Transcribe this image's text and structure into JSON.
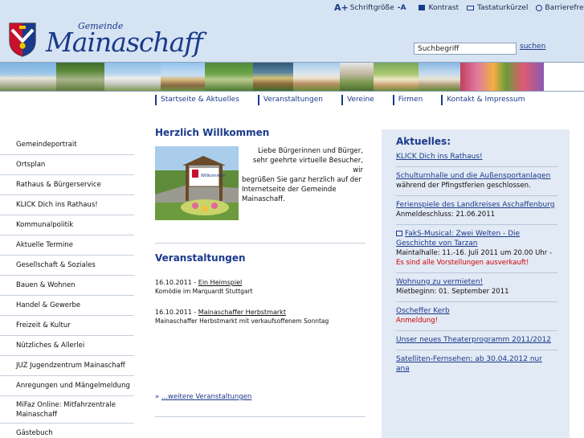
{
  "utility": {
    "font_size_label": "Schriftgröße",
    "font_plus": "A+",
    "font_minus": "-A",
    "contrast": "Kontrast",
    "shortcuts": "Tastaturkürzel",
    "accessible": "Barrierefrei"
  },
  "logo": {
    "small": "Gemeinde",
    "big": "Mainaschaff"
  },
  "search": {
    "value": "Suchbegriff",
    "button": "suchen"
  },
  "nav": {
    "items": [
      "Startseite & Aktuelles",
      "Veranstaltungen",
      "Vereine",
      "Firmen",
      "Kontakt & Impressum"
    ]
  },
  "sidebar": {
    "items": [
      "Gemeindeportrait",
      "Ortsplan",
      "Rathaus & Bürgerservice",
      "KLICK Dich ins Rathaus!",
      "Kommunalpolitik",
      "Aktuelle Termine",
      "Gesellschaft & Soziales",
      "Bauen & Wohnen",
      "Handel & Gewerbe",
      "Freizeit & Kultur",
      "Nützliches & Allerlei",
      "JUZ Jugendzentrum Mainaschaff",
      "Anregungen und Mängelmeldung",
      "MiFaz Online: Mitfahrzentrale Mainaschaff",
      "Gästebuch"
    ]
  },
  "welcome": {
    "heading": "Herzlich Willkommen",
    "text_lines": [
      "Liebe Bürgerinnen und Bürger,",
      "sehr geehrte virtuelle Besucher, wir",
      "begrüßen Sie ganz herzlich auf der",
      "Internetseite der Gemeinde",
      "Mainaschaff."
    ],
    "sign_text": "Willkommen"
  },
  "events": {
    "heading": "Veranstaltungen",
    "items": [
      {
        "date": "16.10.2011 - ",
        "title": "Ein Heimspiel",
        "sub": "Komödie im Marquardt Stuttgart"
      },
      {
        "date": "16.10.2011 - ",
        "title": "Mainaschaffer Herbstmarkt",
        "sub": "Mainaschaffer Herbstmarkt mit verkaufsoffenem Sonntag"
      }
    ],
    "more_prefix": "» ",
    "more": "...weitere Veranstaltungen"
  },
  "aktuelles": {
    "heading": "Aktuelles:",
    "items": [
      {
        "link": "KLICK Dich ins Rathaus!",
        "sub": "",
        "red": ""
      },
      {
        "link": "Schulturnhalle und die Außensportanlagen",
        "sub": "während der Pfingstferien geschlossen.",
        "red": ""
      },
      {
        "link": "Ferienspiele des Landkreises Aschaffenburg",
        "sub": "Anmeldeschluss: 21.06.2011",
        "red": ""
      },
      {
        "link": "FakS-Musical: Zwei Welten - Die Geschichte von Tarzan",
        "sub": "Maintalhalle: 11.-16. Juli 2011 um 20.00 Uhr - ",
        "red": "Es sind alle Vorstellungen ausverkauft!"
      },
      {
        "link": "Wohnung zu vermieten!",
        "sub": "Mietbeginn: 01. September 2011",
        "red": ""
      },
      {
        "link": "Oscheffer Kerb",
        "sub": "",
        "red": "Anmeldung!"
      },
      {
        "link": "Unser neues Theaterprogramm 2011/2012",
        "sub": "",
        "red": ""
      },
      {
        "link": "Satelliten-Fernsehen: ab 30.04.2012 nur ana",
        "sub": "",
        "red": ""
      }
    ]
  },
  "colors": {
    "brand_blue": "#1a3a8a",
    "header_bg": "#d6e3f2",
    "panel_bg": "#e2eaf5",
    "alert_red": "#d00000"
  }
}
